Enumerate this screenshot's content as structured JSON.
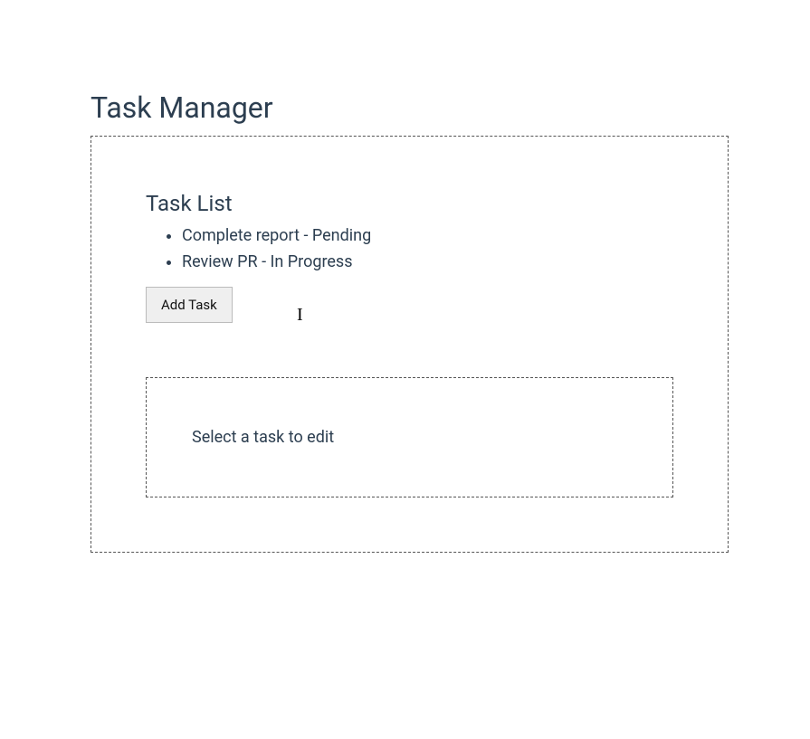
{
  "page_title": "Task Manager",
  "task_list": {
    "heading": "Task List",
    "items": [
      {
        "text": "Complete report - Pending"
      },
      {
        "text": "Review PR - In Progress"
      }
    ],
    "add_button_label": "Add Task"
  },
  "editor": {
    "placeholder_text": "Select a task to edit"
  }
}
